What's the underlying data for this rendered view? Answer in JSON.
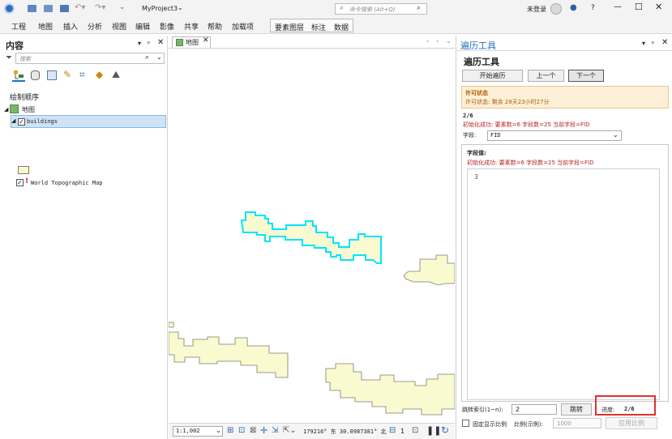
{
  "titlebar": {
    "project": "MyProject3",
    "search_placeholder": "命令搜索 (Alt+Q)",
    "user": "未登录",
    "help": "?"
  },
  "ribbon": {
    "tabs": [
      "工程",
      "地图",
      "插入",
      "分析",
      "视图",
      "编辑",
      "影像",
      "共享",
      "帮助",
      "加载项"
    ],
    "context_tabs": [
      "要素图层",
      "标注",
      "数据"
    ]
  },
  "contents": {
    "title": "内容",
    "search_placeholder": "搜索",
    "drawing_order": "绘制顺序",
    "map_name": "地图",
    "layer1": "buildings",
    "layer2": "World Topographic Map"
  },
  "map": {
    "tab_label": "地图",
    "scale": "1:1,002",
    "coords": "179216° 东 30.0987381° 北",
    "selected_count": "1"
  },
  "tool": {
    "pane_title": "遍历工具",
    "heading": "遍历工具",
    "start_btn": "开始遍历",
    "prev_btn": "上一个",
    "next_btn": "下一个",
    "license_title": "许可状态",
    "license_text": "许可状态: 剩余 28天23小时27分",
    "position": "2/6",
    "init_msg": "初始化成功: 要素数=6 字段数=25 当前字段=FID",
    "field_label": "字段:",
    "field_value": "FID",
    "values_label": "字段值:",
    "values_msg": "初始化成功: 要素数=6 字段数=25 当前字段=FID",
    "value_text": "3",
    "jump_label": "跳转索引(1~n):",
    "jump_value": "2",
    "jump_btn": "跳转",
    "progress_label": "进度:",
    "progress_value": "2/6",
    "fixed_scale_label": "固定显示比例",
    "scale_label": "比例(示例):",
    "scale_value": "1000",
    "apply_btn": "应用比例"
  },
  "colors": {
    "accent": "#1f6fc5",
    "building_fill": "#fafad0",
    "building_stroke": "#7c7c6e",
    "selection": "#00e5ff",
    "highlight_box": "#e0312c",
    "license_bg": "#fdf0d8"
  }
}
